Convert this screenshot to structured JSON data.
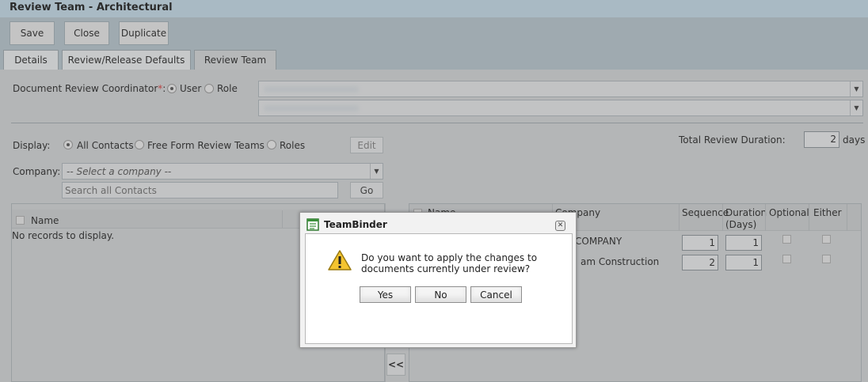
{
  "window": {
    "title": "Review Team - Architectural"
  },
  "toolbar": {
    "save": "Save",
    "close": "Close",
    "duplicate": "Duplicate"
  },
  "tabs": [
    {
      "label": "Details"
    },
    {
      "label": "Review/Release Defaults"
    },
    {
      "label": "Review Team"
    }
  ],
  "coordinator": {
    "label": "Document Review Coordinator",
    "required_mark": "*",
    "colon": ":",
    "option_user": "User",
    "option_role": "Role",
    "selected": "User"
  },
  "display": {
    "label": "Display:",
    "option_all": "All Contacts",
    "option_free": "Free Form Review Teams",
    "option_roles": "Roles",
    "selected": "All Contacts",
    "edit": "Edit"
  },
  "total_duration": {
    "label": "Total Review Duration:",
    "value": "2",
    "unit": "days"
  },
  "company": {
    "label": "Company:",
    "placeholder": "-- Select a company --"
  },
  "search": {
    "placeholder": "Search all Contacts",
    "go": "Go"
  },
  "left_grid": {
    "col_name": "Name",
    "empty": "No records to display."
  },
  "right_grid": {
    "col_name": "Name",
    "col_company": "Company",
    "col_sequence": "Sequence",
    "col_duration": "Duration",
    "col_duration_unit": "(Days)",
    "col_optional": "Optional",
    "col_either": "Either",
    "rows": [
      {
        "company": "COMPANY",
        "sequence": "1",
        "duration": "1"
      },
      {
        "company": "am Construction",
        "sequence": "2",
        "duration": "1"
      }
    ]
  },
  "move_left": "<<",
  "dialog": {
    "title": "TeamBinder",
    "message": "Do you want to apply the changes to documents currently under review?",
    "yes": "Yes",
    "no": "No",
    "cancel": "Cancel"
  },
  "colors": {
    "dialog_bg": "#f2f2f2",
    "overlay": "#b4b6b7",
    "titlebar": "#a9bac4"
  }
}
